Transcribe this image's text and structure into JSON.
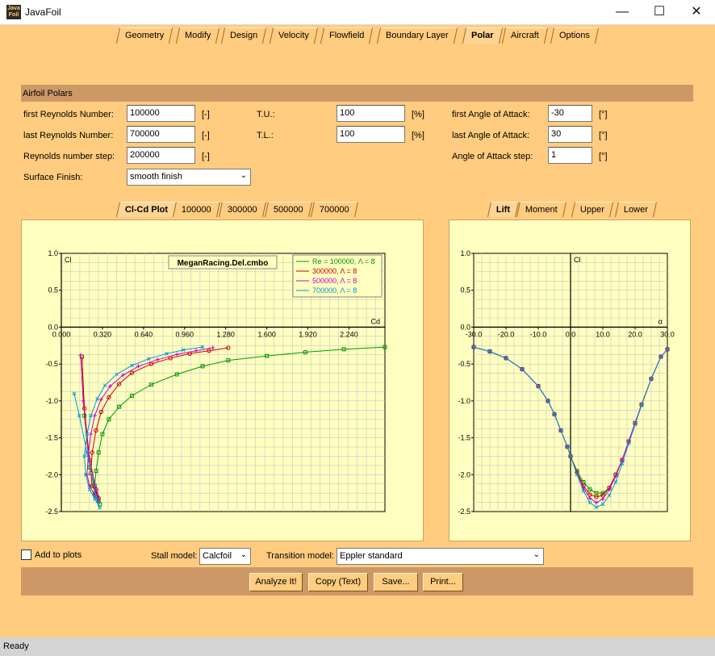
{
  "window": {
    "title": "JavaFoil",
    "icon_text": "Java Foil",
    "minimize": "—",
    "maximize": "☐",
    "close": "✕"
  },
  "tabs": [
    "Geometry",
    "Modify",
    "Design",
    "Velocity",
    "Flowfield",
    "Boundary Layer",
    "Polar",
    "Aircraft",
    "Options"
  ],
  "active_tab": "Polar",
  "section_title": "Airfoil Polars",
  "form": {
    "first_re_label": "first Reynolds Number:",
    "first_re": "100000",
    "first_re_unit": "[-]",
    "last_re_label": "last Reynolds Number:",
    "last_re": "700000",
    "last_re_unit": "[-]",
    "re_step_label": "Reynolds number step:",
    "re_step": "200000",
    "re_step_unit": "[-]",
    "surface_label": "Surface Finish:",
    "surface": "smooth finish",
    "tu_label": "T.U.:",
    "tu": "100",
    "tu_unit": "[%]",
    "tl_label": "T.L.:",
    "tl": "100",
    "tl_unit": "[%]",
    "first_aoa_label": "first Angle of Attack:",
    "first_aoa": "-30",
    "first_aoa_unit": "[°]",
    "last_aoa_label": "last Angle of Attack:",
    "last_aoa": "30",
    "last_aoa_unit": "[°]",
    "aoa_step_label": "Angle of Attack step:",
    "aoa_step": "1",
    "aoa_step_unit": "[°]"
  },
  "left_tabs": [
    "Cl-Cd Plot",
    "100000",
    "300000",
    "500000",
    "700000"
  ],
  "right_tabs": [
    "Lift",
    "Moment",
    "Upper",
    "Lower"
  ],
  "bottom": {
    "add_to_plots": "Add to plots",
    "stall_label": "Stall model:",
    "stall": "Calcfoil",
    "transition_label": "Transition model:",
    "transition": "Eppler standard",
    "buttons": [
      "Analyze It!",
      "Copy (Text)",
      "Save...",
      "Print..."
    ]
  },
  "status": "Ready",
  "colors": {
    "series": [
      "#009900",
      "#cc0000",
      "#cc00cc",
      "#0099cc"
    ]
  },
  "chart_data": [
    {
      "type": "line",
      "title": "MeganRacing.Del.cmbo",
      "xlabel": "Cd",
      "ylabel": "Cl",
      "xlim": [
        0,
        2.52
      ],
      "ylim": [
        -2.5,
        1.0
      ],
      "xticks": [
        "0.000",
        "0.320",
        "0.640",
        "0.960",
        "1.280",
        "1.600",
        "1.920",
        "2.240"
      ],
      "yticks": [
        "1.0",
        "0.5",
        "0.0",
        "-0.5",
        "-1.0",
        "-1.5",
        "-2.0",
        "-2.5"
      ],
      "legend": [
        "Re = 100000, Λ = 8",
        "300000, Λ = 8",
        "500000, Λ = 8",
        "700000, Λ = 8"
      ],
      "series": [
        {
          "name": "Re = 100000, Λ = 8",
          "x": [
            2.52,
            2.2,
            1.9,
            1.6,
            1.3,
            1.1,
            0.9,
            0.7,
            0.55,
            0.45,
            0.37,
            0.32,
            0.29,
            0.27,
            0.26,
            0.26,
            0.27,
            0.29,
            0.3,
            0.28,
            0.22,
            0.18,
            0.16
          ],
          "y": [
            -0.27,
            -0.3,
            -0.34,
            -0.39,
            -0.45,
            -0.53,
            -0.64,
            -0.78,
            -0.93,
            -1.08,
            -1.25,
            -1.45,
            -1.7,
            -1.95,
            -2.15,
            -2.25,
            -2.3,
            -2.35,
            -2.4,
            -2.3,
            -1.9,
            -1.2,
            -0.4
          ]
        },
        {
          "name": "300000, Λ = 8",
          "x": [
            1.3,
            1.15,
            1.0,
            0.85,
            0.7,
            0.55,
            0.45,
            0.37,
            0.31,
            0.27,
            0.24,
            0.23,
            0.24,
            0.27,
            0.29,
            0.27,
            0.22,
            0.18,
            0.16
          ],
          "y": [
            -0.28,
            -0.32,
            -0.36,
            -0.42,
            -0.5,
            -0.62,
            -0.77,
            -0.95,
            -1.15,
            -1.4,
            -1.7,
            -1.98,
            -2.15,
            -2.25,
            -2.32,
            -2.2,
            -1.8,
            -1.1,
            -0.4
          ]
        },
        {
          "name": "500000, Λ = 8",
          "x": [
            1.18,
            1.05,
            0.9,
            0.75,
            0.6,
            0.48,
            0.38,
            0.31,
            0.26,
            0.23,
            0.21,
            0.2,
            0.22,
            0.26,
            0.29,
            0.27,
            0.21,
            0.17,
            0.15
          ],
          "y": [
            -0.28,
            -0.32,
            -0.37,
            -0.44,
            -0.53,
            -0.65,
            -0.8,
            -0.98,
            -1.2,
            -1.45,
            -1.75,
            -2.0,
            -2.15,
            -2.28,
            -2.36,
            -2.2,
            -1.7,
            -1.0,
            -0.38
          ]
        },
        {
          "name": "700000, Λ = 8",
          "x": [
            1.1,
            0.95,
            0.82,
            0.68,
            0.55,
            0.43,
            0.34,
            0.28,
            0.23,
            0.2,
            0.18,
            0.19,
            0.22,
            0.26,
            0.3,
            0.27,
            0.2,
            0.14,
            0.1
          ],
          "y": [
            -0.27,
            -0.31,
            -0.36,
            -0.43,
            -0.52,
            -0.64,
            -0.79,
            -0.97,
            -1.2,
            -1.45,
            -1.75,
            -2.0,
            -2.2,
            -2.33,
            -2.45,
            -2.3,
            -1.7,
            -1.2,
            -0.9
          ]
        }
      ]
    },
    {
      "type": "line",
      "xlabel": "α",
      "ylabel": "Cl",
      "xlim": [
        -30,
        30
      ],
      "ylim": [
        -2.5,
        1.0
      ],
      "xticks": [
        "-30.0",
        "-20.0",
        "-10.0",
        "0.0",
        "10.0",
        "20.0",
        "30.0"
      ],
      "yticks": [
        "1.0",
        "0.5",
        "0.0",
        "-0.5",
        "-1.0",
        "-1.5",
        "-2.0",
        "-2.5"
      ],
      "series": [
        {
          "name": "100000",
          "x": [
            -30,
            -25,
            -20,
            -15,
            -10,
            -7,
            -5,
            -3,
            -1,
            0,
            2,
            4,
            6,
            8,
            10,
            12,
            14,
            16,
            18,
            20,
            22,
            25,
            28,
            30
          ],
          "y": [
            -0.27,
            -0.33,
            -0.42,
            -0.57,
            -0.8,
            -1.0,
            -1.18,
            -1.4,
            -1.62,
            -1.75,
            -1.95,
            -2.1,
            -2.2,
            -2.25,
            -2.25,
            -2.18,
            -2.0,
            -1.8,
            -1.55,
            -1.3,
            -1.05,
            -0.7,
            -0.4,
            -0.3
          ]
        },
        {
          "name": "300000",
          "x": [
            -30,
            -25,
            -20,
            -15,
            -10,
            -7,
            -5,
            -3,
            -1,
            0,
            2,
            4,
            6,
            8,
            10,
            12,
            14,
            16,
            18,
            20,
            22,
            25,
            28,
            30
          ],
          "y": [
            -0.27,
            -0.33,
            -0.42,
            -0.57,
            -0.8,
            -1.0,
            -1.18,
            -1.4,
            -1.62,
            -1.75,
            -1.97,
            -2.15,
            -2.27,
            -2.3,
            -2.28,
            -2.18,
            -2.0,
            -1.8,
            -1.55,
            -1.3,
            -1.05,
            -0.7,
            -0.4,
            -0.3
          ]
        },
        {
          "name": "500000",
          "x": [
            -30,
            -25,
            -20,
            -15,
            -10,
            -7,
            -5,
            -3,
            -1,
            0,
            2,
            4,
            6,
            8,
            10,
            12,
            14,
            16,
            18,
            20,
            22,
            25,
            28,
            30
          ],
          "y": [
            -0.27,
            -0.33,
            -0.42,
            -0.57,
            -0.8,
            -1.0,
            -1.18,
            -1.4,
            -1.62,
            -1.75,
            -1.98,
            -2.18,
            -2.32,
            -2.38,
            -2.33,
            -2.2,
            -2.02,
            -1.8,
            -1.55,
            -1.3,
            -1.05,
            -0.7,
            -0.4,
            -0.3
          ]
        },
        {
          "name": "700000",
          "x": [
            -30,
            -25,
            -20,
            -15,
            -10,
            -7,
            -5,
            -3,
            -1,
            0,
            2,
            4,
            6,
            8,
            10,
            12,
            14,
            16,
            18,
            20,
            22,
            25,
            28,
            30
          ],
          "y": [
            -0.27,
            -0.33,
            -0.42,
            -0.57,
            -0.8,
            -1.0,
            -1.18,
            -1.4,
            -1.62,
            -1.75,
            -2.0,
            -2.22,
            -2.38,
            -2.44,
            -2.4,
            -2.28,
            -2.1,
            -1.85,
            -1.58,
            -1.32,
            -1.06,
            -0.7,
            -0.4,
            -0.3
          ]
        }
      ]
    }
  ]
}
